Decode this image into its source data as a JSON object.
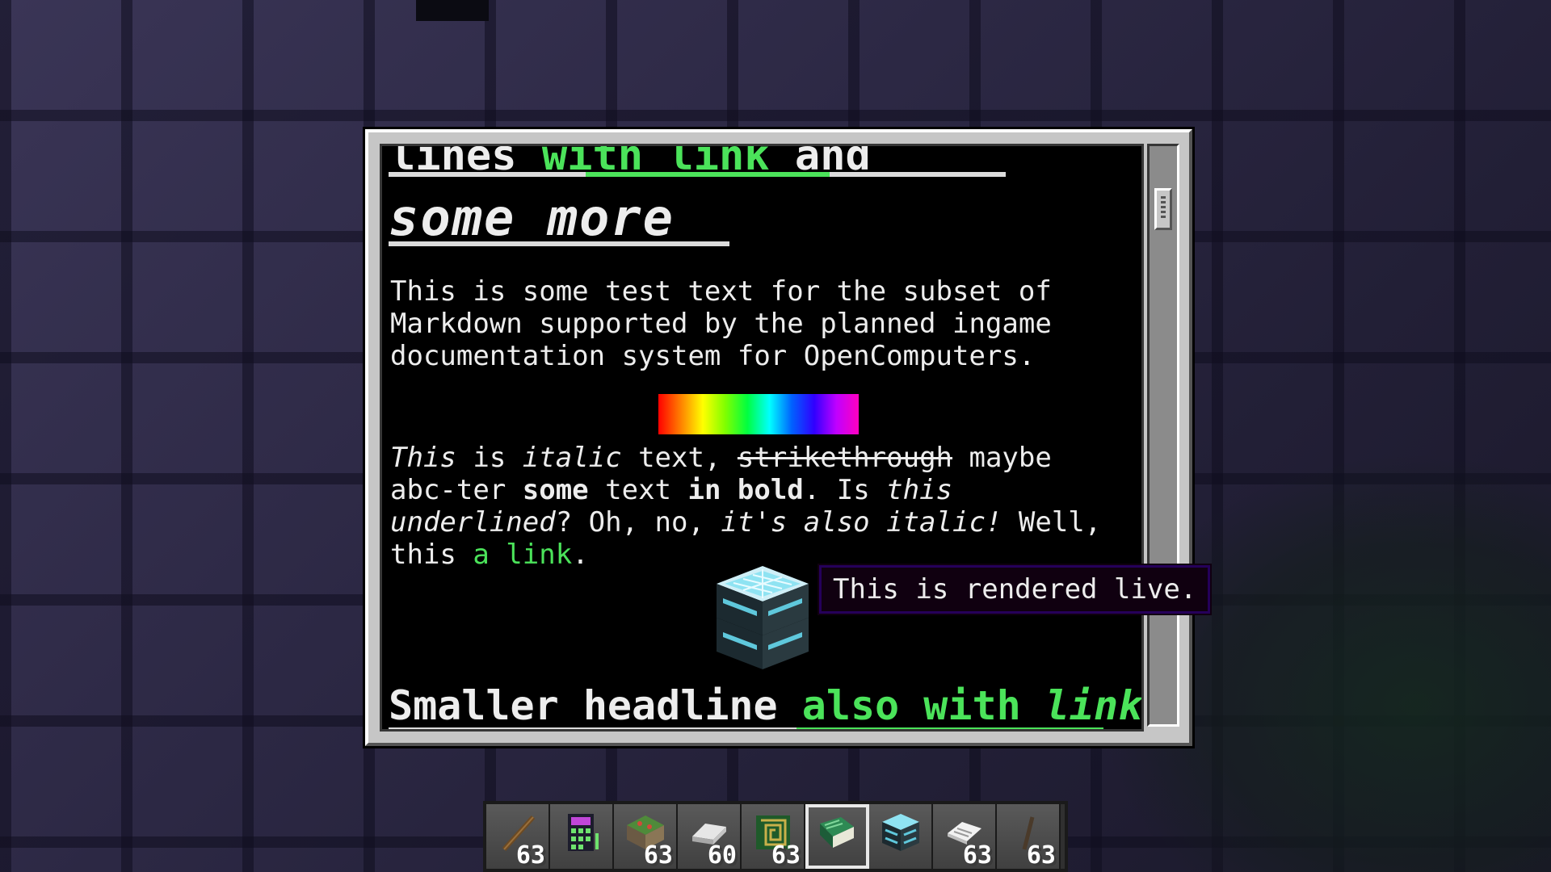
{
  "document": {
    "cut_headline": {
      "part1": "lines ",
      "link": "with link",
      "part2": " and"
    },
    "headline2": "some more",
    "paragraph1": "This is some test text for the subset of Markdown supported by the planned ingame documentation system for OpenComputers.",
    "paragraph2": {
      "t1": "This",
      "t2": " is ",
      "t3": "italic",
      "t4": " text, ",
      "t5": "strikethrough",
      "t6": " maybe abc-ter ",
      "t7": "some",
      "t8": " text ",
      "t9": "in bold",
      "t10": ". Is ",
      "t11": "this underlined",
      "t12": "? Oh, no, ",
      "t13": "it's also italic!",
      "t14": " Well, this ",
      "t15": "a link",
      "t16": "."
    },
    "tooltip": "This is rendered live.",
    "headline3": {
      "text": "Smaller headline ",
      "link_text": "also with ",
      "link_italic": "link"
    }
  },
  "hotbar": {
    "slots": [
      {
        "icon": "stick-icon",
        "count": "63"
      },
      {
        "icon": "calculator-icon",
        "count": ""
      },
      {
        "icon": "circuit-board-icon",
        "count": "63"
      },
      {
        "icon": "iron-ingot-icon",
        "count": "60"
      },
      {
        "icon": "pcb-icon",
        "count": "63"
      },
      {
        "icon": "manual-book-icon",
        "count": ""
      },
      {
        "icon": "server-rack-icon",
        "count": ""
      },
      {
        "icon": "paper-icon",
        "count": "63"
      },
      {
        "icon": "stick-icon",
        "count": "63"
      }
    ],
    "selected_index": 5
  },
  "colors": {
    "link": "#4be35a",
    "text": "#ededed",
    "doc_bg": "#000000",
    "frame": "#c6c6c6"
  }
}
